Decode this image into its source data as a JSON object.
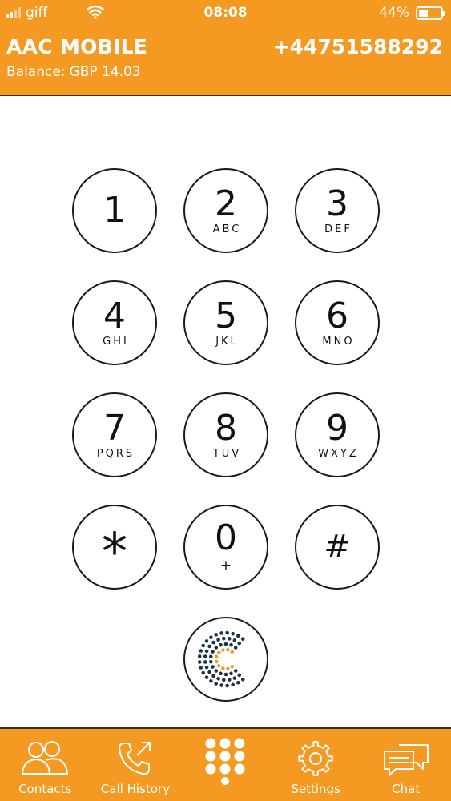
{
  "status_bar": {
    "carrier": "giff",
    "time": "08:08",
    "battery": "44%",
    "battery_level": 0.44
  },
  "header": {
    "title": "AAC MOBILE",
    "phone_number": "+44751588292",
    "balance_label": "Balance:",
    "balance_value": "GBP 14.03"
  },
  "keypad": {
    "keys": [
      {
        "digit": "1",
        "letters": ""
      },
      {
        "digit": "2",
        "letters": "ABC"
      },
      {
        "digit": "3",
        "letters": "DEF"
      },
      {
        "digit": "4",
        "letters": "GHI"
      },
      {
        "digit": "5",
        "letters": "JKL"
      },
      {
        "digit": "6",
        "letters": "MNO"
      },
      {
        "digit": "7",
        "letters": "PQRS"
      },
      {
        "digit": "8",
        "letters": "TUV"
      },
      {
        "digit": "9",
        "letters": "WXYZ"
      },
      {
        "digit": "*",
        "letters": ""
      },
      {
        "digit": "0",
        "letters": "+"
      },
      {
        "digit": "#",
        "letters": ""
      }
    ],
    "call_button_icon": "aac-logo-icon"
  },
  "nav": {
    "items": [
      {
        "label": "Contacts",
        "icon": "contacts-icon"
      },
      {
        "label": "Call History",
        "icon": "call-history-icon"
      },
      {
        "label": "",
        "icon": "dialpad-icon"
      },
      {
        "label": "Settings",
        "icon": "gear-icon"
      },
      {
        "label": "Chat",
        "icon": "chat-icon"
      }
    ]
  },
  "colors": {
    "brand_orange": "#F49A22",
    "logo_dark": "#1f3340",
    "logo_accent": "#F49A22"
  }
}
